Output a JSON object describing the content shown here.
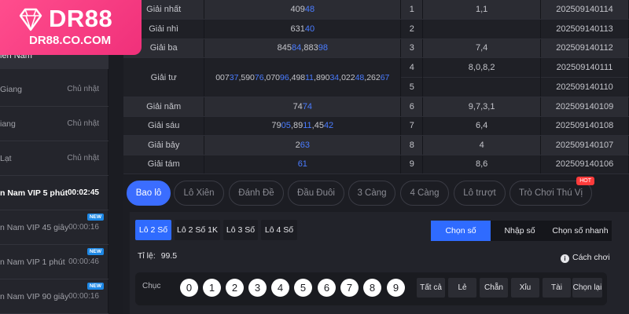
{
  "logo": {
    "brand": "DR88",
    "url": "DR88.CO.COM"
  },
  "sidebar": {
    "tab_label": "iền Nam",
    "tab_extra": "",
    "items": [
      {
        "label": "Giang",
        "day": "Chủ nhật"
      },
      {
        "label": "iang",
        "day": "Chủ nhật"
      },
      {
        "label": "Lạt",
        "day": "Chủ nhật"
      },
      {
        "label": "n Nam VIP 5 phút",
        "day": "00:02:45",
        "active": true
      },
      {
        "label": "n Nam VIP 45 giây",
        "day": "00:00:16",
        "badge": "NEW"
      },
      {
        "label": "n Nam VIP 1 phút",
        "day": "00:00:46",
        "badge": "NEW"
      },
      {
        "label": "n Nam VIP 90 giây",
        "day": "00:00:16",
        "badge": "NEW"
      }
    ]
  },
  "results": {
    "rows": [
      {
        "prize": "Giải nhất",
        "n_black": "409",
        "n_blue": "48",
        "idx": "1",
        "val": "1,1",
        "code": "202509140114"
      },
      {
        "prize": "Giải nhì",
        "n_black": "631",
        "n_blue": "40",
        "idx": "2",
        "val": "",
        "code": "202509140113"
      },
      {
        "prize": "Giải ba",
        "idx": "3",
        "val": "7,4",
        "code": "202509140112"
      },
      {
        "prize": "Giải tư",
        "idx4": "4",
        "val4": "8,0,8,2",
        "code4": "202509140111",
        "idx5": "5",
        "val5": "",
        "code5": "202509140110"
      },
      {
        "prize": "Giải năm",
        "n_black": "74",
        "n_blue": "74",
        "idx": "6",
        "val": "9,7,3,1",
        "code": "202509140109"
      },
      {
        "prize": "Giải sáu",
        "idx": "7",
        "val": "6,4",
        "code": "202509140108"
      },
      {
        "prize": "Giải bảy",
        "n_black": "2",
        "n_blue": "63",
        "idx": "8",
        "val": "4",
        "code": "202509140107"
      },
      {
        "prize": "Giải tám",
        "n_black": "",
        "n_blue": "61",
        "idx": "9",
        "val": "8,6",
        "code": "202509140106"
      }
    ]
  },
  "tabs": [
    {
      "label": "Bao lô",
      "active": true
    },
    {
      "label": "Lô Xiên"
    },
    {
      "label": "Đánh Đề"
    },
    {
      "label": "Đầu Đuôi"
    },
    {
      "label": "3 Càng"
    },
    {
      "label": "4 Càng"
    },
    {
      "label": "Lô trượt"
    },
    {
      "label": "Trò Chơi Thú Vị",
      "badge": "HOT"
    }
  ],
  "subtabs": [
    {
      "label": "Lô 2 Số",
      "active": true
    },
    {
      "label": "Lô 2 Số 1K"
    },
    {
      "label": "Lô 3 Số"
    },
    {
      "label": "Lô 4 Số"
    }
  ],
  "modes": [
    {
      "label": "Chọn số",
      "active": true
    },
    {
      "label": "Nhập số"
    },
    {
      "label": "Chọn số nhanh"
    }
  ],
  "ratio": {
    "label": "Tỉ lệ:",
    "value": "99.5"
  },
  "help": {
    "label": "Cách chơi"
  },
  "picker": {
    "row_label": "Chục",
    "digits": [
      "0",
      "1",
      "2",
      "3",
      "4",
      "5",
      "6",
      "7",
      "8",
      "9"
    ],
    "quick": [
      "Tất cả",
      "Lẻ",
      "Chẵn",
      "Xỉu",
      "Tài",
      "Chọn lại"
    ]
  },
  "colors": {
    "accent": "#2f6bff",
    "brand": "#f0307a",
    "highlight": "#4a7cff"
  }
}
